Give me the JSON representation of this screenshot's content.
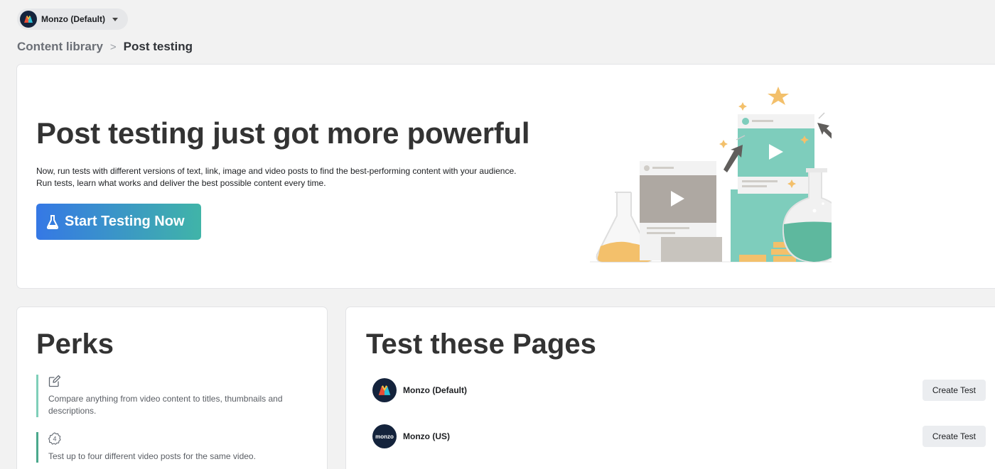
{
  "account": {
    "name": "Monzo (Default)"
  },
  "breadcrumb": {
    "parent": "Content library",
    "separator": ">",
    "current": "Post testing"
  },
  "hero": {
    "title": "Post testing just got more powerful",
    "description_line1": "Now, run tests with different versions of text, link, image and video posts to find the best-performing content with your audience.",
    "description_line2": "Run tests, learn what works and deliver the best possible content every time.",
    "cta_label": "Start Testing Now"
  },
  "perks": {
    "title": "Perks",
    "items": [
      {
        "icon": "edit-icon",
        "text": "Compare anything from video content to titles, thumbnails and descriptions."
      },
      {
        "icon": "four-badge-icon",
        "badge": "4",
        "text": "Test up to four different video posts for the same video."
      }
    ]
  },
  "pages_section": {
    "title": "Test these Pages",
    "pages": [
      {
        "name": "Monzo (Default)",
        "avatar": "monzo-logo-icon",
        "button_label": "Create Test"
      },
      {
        "name": "Monzo (US)",
        "avatar": "monzo-wordmark-icon",
        "avatar_text": "monzo",
        "button_label": "Create Test"
      }
    ]
  },
  "colors": {
    "cta_gradient_start": "#3578e5",
    "cta_gradient_end": "#40b4a8",
    "perk_accent_1": "#7fcfb9",
    "perk_accent_2": "#4aa88c",
    "avatar_bg": "#14233c"
  }
}
